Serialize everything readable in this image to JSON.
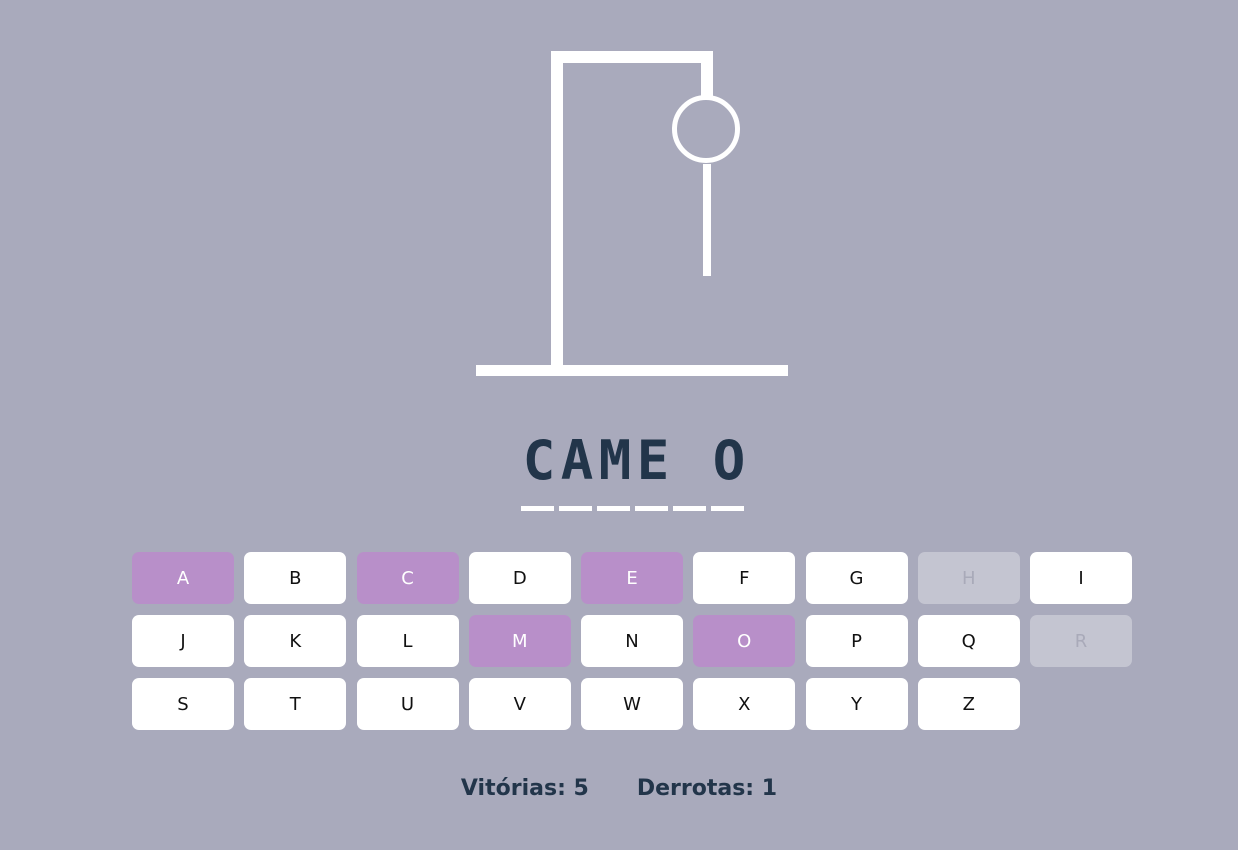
{
  "game": {
    "word_slots": [
      "C",
      "A",
      "M",
      "E",
      "",
      "O"
    ],
    "keys": [
      {
        "letter": "A",
        "state": "used"
      },
      {
        "letter": "B",
        "state": "available"
      },
      {
        "letter": "C",
        "state": "used"
      },
      {
        "letter": "D",
        "state": "available"
      },
      {
        "letter": "E",
        "state": "used"
      },
      {
        "letter": "F",
        "state": "available"
      },
      {
        "letter": "G",
        "state": "available"
      },
      {
        "letter": "H",
        "state": "disabled"
      },
      {
        "letter": "I",
        "state": "available"
      },
      {
        "letter": "J",
        "state": "available"
      },
      {
        "letter": "K",
        "state": "available"
      },
      {
        "letter": "L",
        "state": "available"
      },
      {
        "letter": "M",
        "state": "used"
      },
      {
        "letter": "N",
        "state": "available"
      },
      {
        "letter": "O",
        "state": "used"
      },
      {
        "letter": "P",
        "state": "available"
      },
      {
        "letter": "Q",
        "state": "available"
      },
      {
        "letter": "R",
        "state": "disabled"
      },
      {
        "letter": "S",
        "state": "available"
      },
      {
        "letter": "T",
        "state": "available"
      },
      {
        "letter": "U",
        "state": "available"
      },
      {
        "letter": "V",
        "state": "available"
      },
      {
        "letter": "W",
        "state": "available"
      },
      {
        "letter": "X",
        "state": "available"
      },
      {
        "letter": "Y",
        "state": "available"
      },
      {
        "letter": "Z",
        "state": "available"
      }
    ]
  },
  "stats": {
    "wins_label": "Vitórias: 5",
    "losses_label": "Derrotas: 1"
  },
  "colors": {
    "background": "#a9aabc",
    "used_key": "#b88fc9",
    "disabled_key": "#c4c5d1",
    "text_dark": "#22354a"
  }
}
